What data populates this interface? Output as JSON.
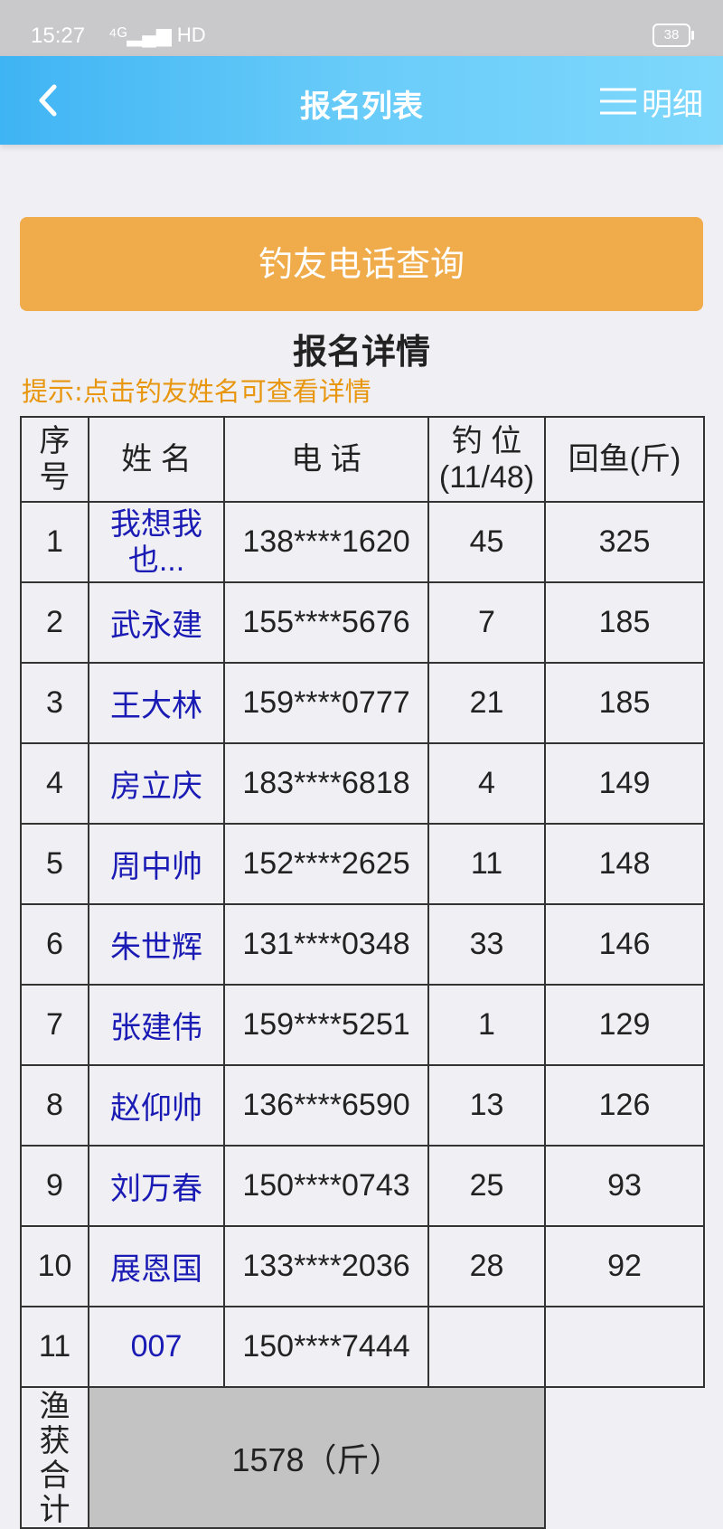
{
  "status_bar": {
    "time": "15:27",
    "network": "⁴ᴳ▂▄▆ HD",
    "battery": "38"
  },
  "nav": {
    "title": "报名列表",
    "menu_label": "明细"
  },
  "query_button": "钓友电话查询",
  "section_title": "报名详情",
  "hint": "提示:点击钓友姓名可查看详情",
  "table": {
    "headers": {
      "index": "序号",
      "name": "姓 名",
      "phone": "电 话",
      "spot": "钓 位",
      "spot_count": "(11/48)",
      "catch": "回鱼(斤)"
    },
    "rows": [
      {
        "index": "1",
        "name": "我想我也...",
        "phone": "138****1620",
        "spot": "45",
        "catch": "325"
      },
      {
        "index": "2",
        "name": "武永建",
        "phone": "155****5676",
        "spot": "7",
        "catch": "185"
      },
      {
        "index": "3",
        "name": "王大林",
        "phone": "159****0777",
        "spot": "21",
        "catch": "185"
      },
      {
        "index": "4",
        "name": "房立庆",
        "phone": "183****6818",
        "spot": "4",
        "catch": "149"
      },
      {
        "index": "5",
        "name": "周中帅",
        "phone": "152****2625",
        "spot": "11",
        "catch": "148"
      },
      {
        "index": "6",
        "name": "朱世辉",
        "phone": "131****0348",
        "spot": "33",
        "catch": "146"
      },
      {
        "index": "7",
        "name": "张建伟",
        "phone": "159****5251",
        "spot": "1",
        "catch": "129"
      },
      {
        "index": "8",
        "name": "赵仰帅",
        "phone": "136****6590",
        "spot": "13",
        "catch": "126"
      },
      {
        "index": "9",
        "name": "刘万春",
        "phone": "150****0743",
        "spot": "25",
        "catch": "93"
      },
      {
        "index": "10",
        "name": "展恩国",
        "phone": "133****2036",
        "spot": "28",
        "catch": "92"
      },
      {
        "index": "11",
        "name": "007",
        "phone": "150****7444",
        "spot": "",
        "catch": ""
      }
    ],
    "total_label": "渔获合计",
    "total_value": "1578（斤）"
  },
  "colors": {
    "nav": "#5ec4f8",
    "query_button": "#f0ab4a",
    "hint": "#e8960e",
    "name_link": "#1a1ab4",
    "total_bg": "#c3c3c3"
  }
}
